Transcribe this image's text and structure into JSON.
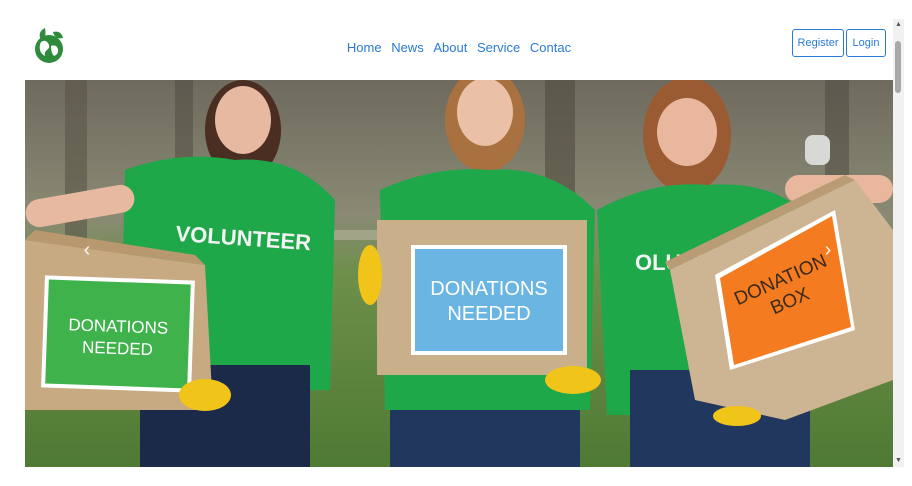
{
  "logo": {
    "icon": "globe-leaf-icon",
    "color": "#2e8b3c"
  },
  "nav": {
    "links": [
      "Home",
      "News",
      "About",
      "Service",
      "Contac"
    ],
    "link_color": "#2b7bd6"
  },
  "auth": {
    "register_label": "Register",
    "login_label": "Login"
  },
  "hero": {
    "shirt_text_left": "VOLUNTEER",
    "shirt_text_right": "OLUNT",
    "box_left": {
      "line1": "DONATIONS",
      "line2": "NEEDED",
      "color": "#3fb24c"
    },
    "box_middle": {
      "line1": "DONATIONS",
      "line2": "NEEDED",
      "color": "#6bb5e3"
    },
    "box_right": {
      "line1": "DONATION",
      "line2": "BOX",
      "color": "#f47b20"
    },
    "arrow_prev": "‹",
    "arrow_next": "›"
  },
  "scrollbar": {
    "up": "▲",
    "down": "▼"
  }
}
